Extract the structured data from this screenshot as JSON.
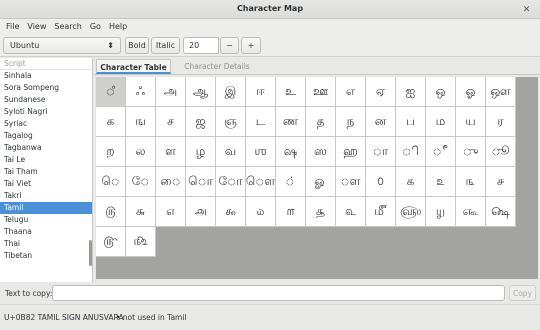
{
  "window": {
    "title": "Character Map",
    "close_glyph": "✕"
  },
  "menu": [
    "File",
    "View",
    "Search",
    "Go",
    "Help"
  ],
  "toolbar": {
    "font": "Ubuntu",
    "font_arrow": "⬍",
    "bold_label": "Bold",
    "italic_label": "Italic",
    "size_value": "20",
    "minus_label": "−",
    "plus_label": "+"
  },
  "sidebar": {
    "header": "Script",
    "items": [
      "Sinhala",
      "Sora Sompeng",
      "Sundanese",
      "Syloti Nagri",
      "Syriac",
      "Tagalog",
      "Tagbanwa",
      "Tai Le",
      "Tai Tham",
      "Tai Viet",
      "Takri",
      "Tamil",
      "Telugu",
      "Thaana",
      "Thai",
      "Tibetan"
    ],
    "selected_index": 11
  },
  "tabs": {
    "table": "Character Table",
    "details": "Character Details"
  },
  "grid": {
    "columns": 15,
    "selected_index": 0,
    "chars": [
      "◌ஂ",
      "ஃ",
      "அ",
      "ஆ",
      "இ",
      "ஈ",
      "உ",
      "ஊ",
      "எ",
      "ஏ",
      "ஐ",
      "ஒ",
      "ஓ",
      "ஔ",
      "",
      "க",
      "ங",
      "ச",
      "ஜ",
      "ஞ",
      "ட",
      "ண",
      "த",
      "ந",
      "ன",
      "ப",
      "ம",
      "ய",
      "ர",
      "",
      "ற",
      "ல",
      "ள",
      "ழ",
      "வ",
      "ஶ",
      "ஷ",
      "ஸ",
      "ஹ",
      "◌ா",
      "◌ி",
      "◌ீ",
      "◌ு",
      "◌ூ",
      "",
      "◌ெ",
      "◌ே",
      "◌ை",
      "◌ொ",
      "◌ோ",
      "◌ௌ",
      "◌்",
      "ௐ",
      "◌ௗ",
      "௦",
      "௧",
      "௨",
      "௩",
      "௪",
      "",
      "௫",
      "௬",
      "௭",
      "௮",
      "௯",
      "௰",
      "௱",
      "௲",
      "௳",
      "௴",
      "௵",
      "௶",
      "௷",
      "௸",
      "",
      "௹",
      "௺",
      "",
      "",
      "",
      "",
      "",
      "",
      "",
      "",
      "",
      "",
      "",
      "",
      ""
    ]
  },
  "copy": {
    "label": "Text to copy:",
    "value": "",
    "button": "Copy"
  },
  "status": {
    "code": "U+0B82 TAMIL SIGN ANUSVARA",
    "note": "• not used in Tamil"
  }
}
